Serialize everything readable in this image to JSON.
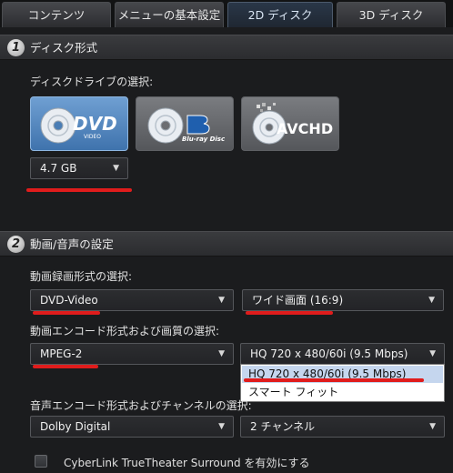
{
  "tabs": [
    {
      "label": "コンテンツ",
      "active": false
    },
    {
      "label": "メニューの基本設定",
      "active": false
    },
    {
      "label": "2D ディスク",
      "active": true
    },
    {
      "label": "3D ディスク",
      "active": false
    }
  ],
  "section1": {
    "number": "1",
    "title": "ディスク形式",
    "drive_label": "ディスクドライブの選択:",
    "disc_types": [
      {
        "name": "DVD",
        "sub": "VIDEO",
        "selected": true
      },
      {
        "name": "Blu-ray Disc",
        "selected": false
      },
      {
        "name": "AVCHD",
        "selected": false
      }
    ],
    "capacity": "4.7 GB"
  },
  "section2": {
    "number": "2",
    "title": "動画/音声の設定",
    "video_format_label": "動画録画形式の選択:",
    "video_format": "DVD-Video",
    "aspect": "ワイド画面 (16:9)",
    "encode_label": "動画エンコード形式および画質の選択:",
    "encode": "MPEG-2",
    "quality": "HQ 720 x 480/60i (9.5 Mbps)",
    "quality_options": [
      "HQ 720 x 480/60i (9.5 Mbps)",
      "スマート フィット"
    ],
    "audio_label": "音声エンコード形式およびチャンネルの選択:",
    "audio_format": "Dolby Digital",
    "audio_channels": "2 チャンネル",
    "surround_label": "CyberLink TrueTheater Surround を有効にする",
    "surround_checked": false
  },
  "colors": {
    "highlight_underline": "#e01c1c",
    "selected_disc": "#4f85c0"
  }
}
